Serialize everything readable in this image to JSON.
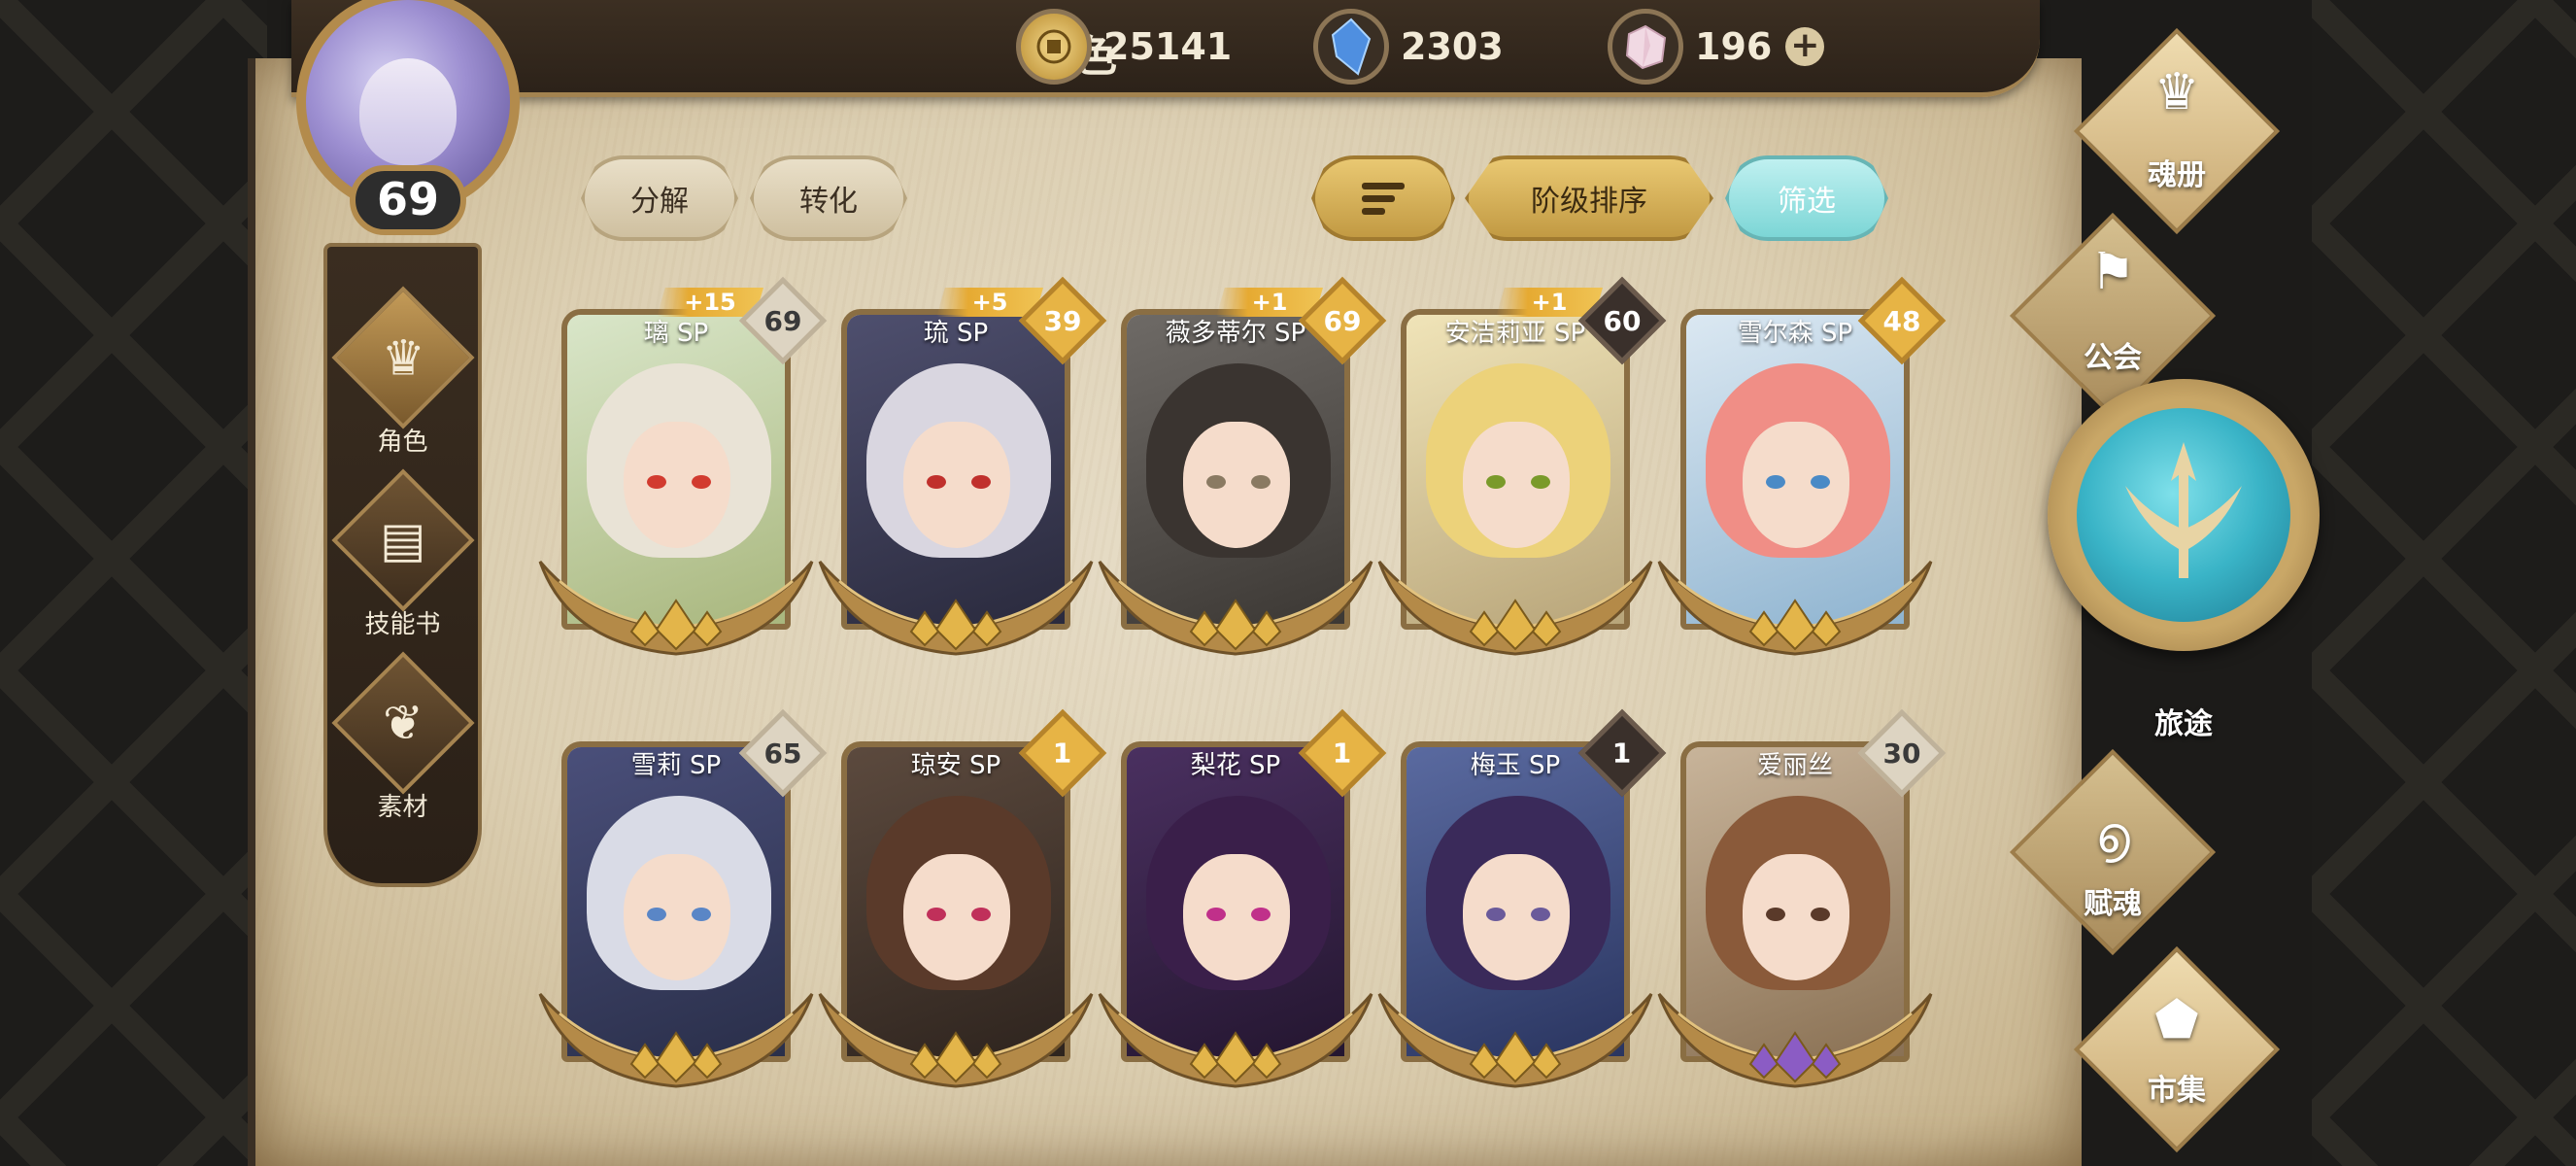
{
  "player": {
    "name": "雪色",
    "level": "69"
  },
  "resources": [
    {
      "icon": "gold-coin-icon",
      "value": "25141"
    },
    {
      "icon": "blue-crystal-icon",
      "value": "2303"
    },
    {
      "icon": "pink-gem-icon",
      "value": "196",
      "plus": "+"
    }
  ],
  "left_nav": [
    {
      "label": "角色",
      "icon": "character-icon",
      "active": true
    },
    {
      "label": "技能书",
      "icon": "skill-book-icon",
      "active": false
    },
    {
      "label": "素材",
      "icon": "material-icon",
      "active": false
    }
  ],
  "buttons": {
    "decompose": "分解",
    "convert": "转化",
    "rank_sort": "阶级排序",
    "filter": "筛选"
  },
  "characters": [
    {
      "name": "璃 SP",
      "level": "69",
      "bonus": "+15",
      "badge": "silver",
      "hair": "#e9e3d6",
      "eye": "#d23b2f"
    },
    {
      "name": "琉 SP",
      "level": "39",
      "bonus": "+5",
      "badge": "gold",
      "hair": "#d9d6e0",
      "eye": "#c0302c"
    },
    {
      "name": "薇多蒂尔 SP",
      "level": "69",
      "bonus": "+1",
      "badge": "gold",
      "hair": "#3a3430",
      "eye": "#8a7a62"
    },
    {
      "name": "安洁莉亚 SP",
      "level": "60",
      "bonus": "+1",
      "badge": "dark",
      "hair": "#ecd27a",
      "eye": "#7a9a2a"
    },
    {
      "name": "雪尔森 SP",
      "level": "48",
      "bonus": "",
      "badge": "gold",
      "hair": "#f08e86",
      "eye": "#4a8ac6"
    },
    {
      "name": "雪莉 SP",
      "level": "65",
      "bonus": "",
      "badge": "silver",
      "hair": "#d9dbe6",
      "eye": "#5a86c6"
    },
    {
      "name": "琼安 SP",
      "level": "1",
      "bonus": "",
      "badge": "gold",
      "hair": "#5a3a2a",
      "eye": "#c0305a"
    },
    {
      "name": "梨花 SP",
      "level": "1",
      "bonus": "",
      "badge": "gold",
      "hair": "#3a1f4a",
      "eye": "#c0308a"
    },
    {
      "name": "梅玉 SP",
      "level": "1",
      "bonus": "",
      "badge": "dark",
      "hair": "#3a2a5a",
      "eye": "#6a5a9a"
    },
    {
      "name": "爱丽丝",
      "level": "30",
      "bonus": "",
      "badge": "silver",
      "hair": "#8a5a3a",
      "eye": "#5a3a2a"
    }
  ],
  "right_nav": [
    {
      "label": "魂册",
      "icon": "soul-book-icon"
    },
    {
      "label": "公会",
      "icon": "guild-icon"
    },
    {
      "label": "旅途",
      "icon": "journey-icon"
    },
    {
      "label": "赋魂",
      "icon": "soul-infuse-icon"
    },
    {
      "label": "市集",
      "icon": "market-icon"
    }
  ],
  "colors": {
    "accent_gold": "#e7b445",
    "teal": "#7cd6d6",
    "parchment": "#dccfb2"
  }
}
